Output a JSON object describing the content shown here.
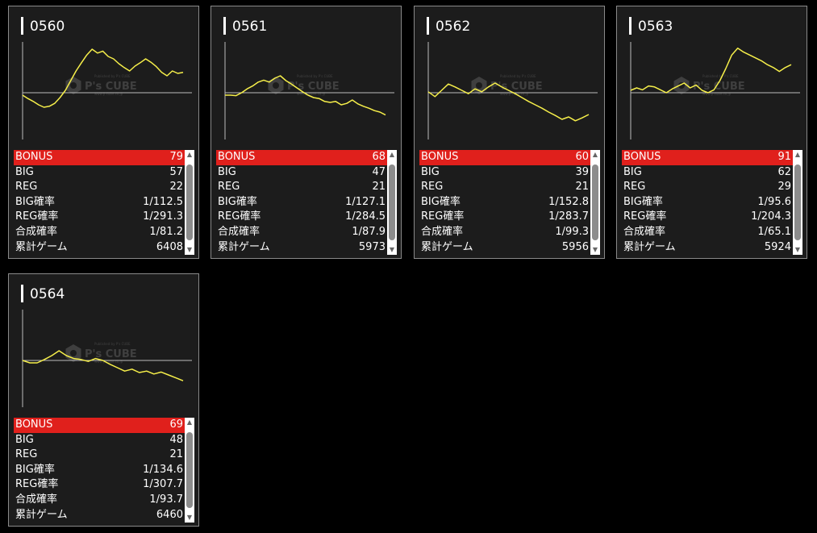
{
  "colors": {
    "line": "#f6ef4a",
    "bonus_bg": "#e0201c",
    "card_bg": "#1c1c1c"
  },
  "stat_labels": {
    "bonus": "BONUS",
    "big": "BIG",
    "reg": "REG",
    "big_rate": "BIG確率",
    "reg_rate": "REG確率",
    "combined_rate": "合成確率",
    "total_games": "累計ゲーム"
  },
  "watermark": {
    "brand": "P's CUBE",
    "tagline": "Published by P's CUBE",
    "subline": "www.p-cube.co.jp"
  },
  "scroll_icons": {
    "up": "▲",
    "down": "▼"
  },
  "machines": [
    {
      "id": "0560",
      "stats": {
        "bonus": "79",
        "big": "57",
        "reg": "22",
        "big_rate": "1/112.5",
        "reg_rate": "1/291.3",
        "combined_rate": "1/81.2",
        "total_games": "6408"
      },
      "chart_data": {
        "type": "line",
        "xlim": [
          0,
          1
        ],
        "ylim": [
          -1,
          1
        ],
        "values": [
          -0.05,
          -0.12,
          -0.18,
          -0.25,
          -0.3,
          -0.28,
          -0.22,
          -0.1,
          0.05,
          0.25,
          0.45,
          0.62,
          0.78,
          0.9,
          0.82,
          0.86,
          0.75,
          0.7,
          0.6,
          0.52,
          0.45,
          0.55,
          0.62,
          0.7,
          0.63,
          0.54,
          0.42,
          0.35,
          0.45,
          0.4,
          0.42
        ]
      }
    },
    {
      "id": "0561",
      "stats": {
        "bonus": "68",
        "big": "47",
        "reg": "21",
        "big_rate": "1/127.1",
        "reg_rate": "1/284.5",
        "combined_rate": "1/87.9",
        "total_games": "5973"
      },
      "chart_data": {
        "type": "line",
        "xlim": [
          0,
          1
        ],
        "ylim": [
          -1,
          1
        ],
        "values": [
          -0.05,
          -0.05,
          -0.06,
          0.0,
          0.08,
          0.14,
          0.22,
          0.26,
          0.22,
          0.3,
          0.35,
          0.25,
          0.18,
          0.1,
          0.02,
          -0.05,
          -0.1,
          -0.12,
          -0.18,
          -0.2,
          -0.18,
          -0.25,
          -0.22,
          -0.15,
          -0.23,
          -0.28,
          -0.32,
          -0.37,
          -0.4,
          -0.46
        ]
      }
    },
    {
      "id": "0562",
      "stats": {
        "bonus": "60",
        "big": "39",
        "reg": "21",
        "big_rate": "1/152.8",
        "reg_rate": "1/283.7",
        "combined_rate": "1/99.3",
        "total_games": "5956"
      },
      "chart_data": {
        "type": "line",
        "xlim": [
          0,
          1
        ],
        "ylim": [
          -1,
          1
        ],
        "values": [
          0.02,
          -0.08,
          0.05,
          0.18,
          0.12,
          0.05,
          -0.02,
          0.08,
          0.02,
          0.12,
          0.2,
          0.12,
          0.05,
          -0.02,
          -0.1,
          -0.18,
          -0.25,
          -0.32,
          -0.4,
          -0.47,
          -0.55,
          -0.5,
          -0.58,
          -0.52,
          -0.45
        ]
      }
    },
    {
      "id": "0563",
      "stats": {
        "bonus": "91",
        "big": "62",
        "reg": "29",
        "big_rate": "1/95.6",
        "reg_rate": "1/204.3",
        "combined_rate": "1/65.1",
        "total_games": "5924"
      },
      "chart_data": {
        "type": "line",
        "xlim": [
          0,
          1
        ],
        "ylim": [
          -1,
          1
        ],
        "values": [
          0.05,
          0.1,
          0.06,
          0.14,
          0.12,
          0.06,
          0.0,
          0.08,
          0.14,
          0.2,
          0.1,
          0.16,
          0.05,
          0.0,
          0.06,
          0.25,
          0.5,
          0.78,
          0.92,
          0.84,
          0.78,
          0.72,
          0.66,
          0.58,
          0.52,
          0.44,
          0.52,
          0.58
        ]
      }
    },
    {
      "id": "0564",
      "stats": {
        "bonus": "69",
        "big": "48",
        "reg": "21",
        "big_rate": "1/134.6",
        "reg_rate": "1/307.7",
        "combined_rate": "1/93.7",
        "total_games": "6460"
      },
      "chart_data": {
        "type": "line",
        "xlim": [
          0,
          1
        ],
        "ylim": [
          -1,
          1
        ],
        "values": [
          0.0,
          -0.05,
          -0.05,
          0.02,
          0.1,
          0.2,
          0.1,
          0.04,
          0.02,
          -0.02,
          0.04,
          0.0,
          -0.08,
          -0.15,
          -0.22,
          -0.18,
          -0.25,
          -0.22,
          -0.28,
          -0.24,
          -0.3,
          -0.36,
          -0.42
        ]
      }
    }
  ]
}
